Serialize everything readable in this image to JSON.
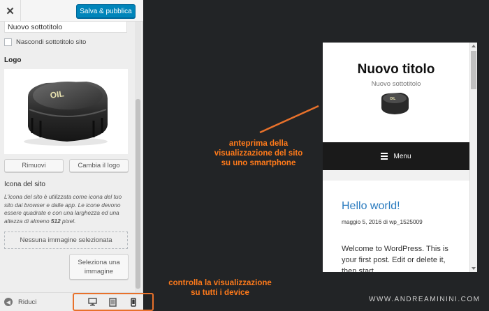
{
  "topbar": {
    "close_icon": "close-icon",
    "publish_label": "Salva & pubblica"
  },
  "site_identity": {
    "tagline_value": "Nuovo sottotitolo",
    "hide_tagline_label": "Nascondi sottotitolo sito",
    "logo_heading": "Logo",
    "remove_label": "Rimuovi",
    "change_logo_label": "Cambia il logo",
    "site_icon_heading": "Icona del sito",
    "site_icon_desc_1": "L'icona del sito è utilizzata come icona del tuo sito dai browser e dalle app. Le icone devono essere quadrate e con una larghezza ed una altezza di almeno ",
    "site_icon_desc_bold": "512",
    "site_icon_desc_2": " pixel.",
    "no_image_label": "Nessuna immagine selezionata",
    "select_image_label_1": "Seleziona una",
    "select_image_label_2": "immagine"
  },
  "footer": {
    "collapse_label": "Riduci",
    "devices": [
      "desktop-icon",
      "tablet-icon",
      "mobile-icon"
    ]
  },
  "preview": {
    "site_title": "Nuovo titolo",
    "site_tagline": "Nuovo sottotitolo",
    "menu_label": "Menu",
    "post_title": "Hello world!",
    "post_meta": "maggio 5, 2016 di wp_1525009",
    "post_body": "Welcome to WordPress. This is your first post. Edit or delete it, then start"
  },
  "annotations": {
    "preview_note_1": "anteprima della",
    "preview_note_2": "visualizzazione del sito",
    "preview_note_3": "su uno smartphone",
    "devices_note_1": "controlla la visualizzazione",
    "devices_note_2": "su tutti i device",
    "watermark": "WWW.ANDREAMININI.COM"
  },
  "colors": {
    "accent": "#0085ba",
    "annotation": "#ff7a1a",
    "link": "#2a7bbf"
  }
}
